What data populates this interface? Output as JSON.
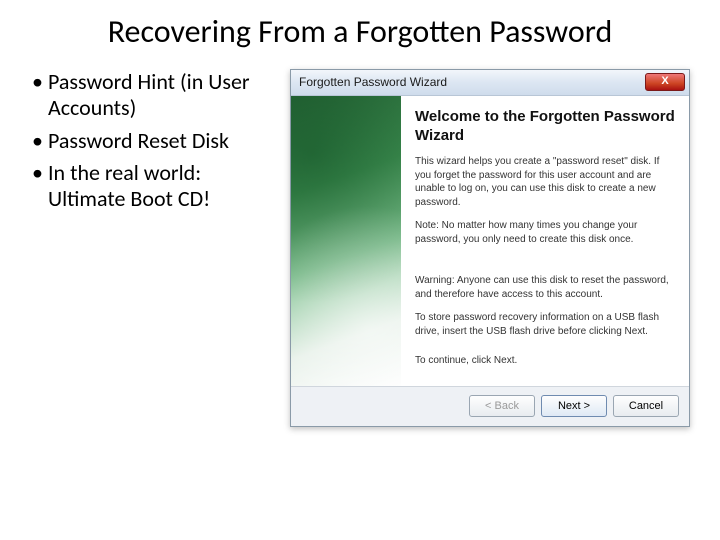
{
  "slide": {
    "title": "Recovering From a Forgotten Password",
    "bullets": [
      "Password Hint (in User Accounts)",
      "Password Reset Disk",
      "In the real world: Ultimate Boot CD!"
    ]
  },
  "wizard": {
    "window_title": "Forgotten Password Wizard",
    "close_label": "X",
    "heading": "Welcome to the Forgotten Password Wizard",
    "para_intro": "This wizard helps you create a \"password reset\" disk. If you forget the password for this user account and are unable to log on, you can use this disk to create a new password.",
    "para_note": "Note: No matter how many times you change your password, you only need to create this disk once.",
    "para_warning": "Warning: Anyone can use this disk to reset the password, and therefore have access to this account.",
    "para_usb": "To store password recovery information on a USB flash drive, insert the USB flash drive before clicking Next.",
    "para_continue": "To continue, click Next.",
    "buttons": {
      "back": "< Back",
      "next": "Next >",
      "cancel": "Cancel"
    }
  }
}
